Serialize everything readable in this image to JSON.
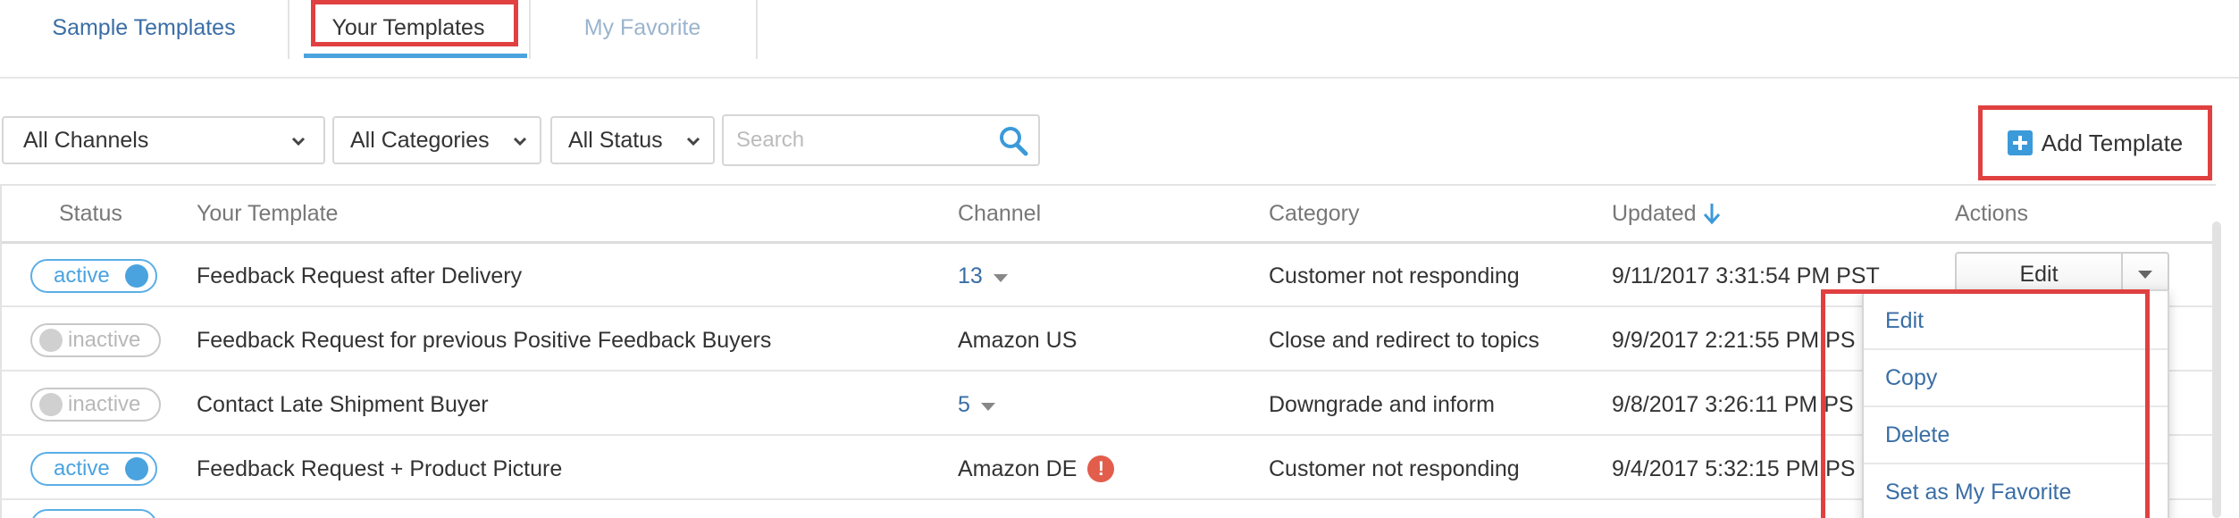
{
  "tabs": [
    {
      "label": "Sample Templates"
    },
    {
      "label": "Your Templates"
    },
    {
      "label": "My Favorite"
    }
  ],
  "filters": {
    "channel": "All Channels",
    "category": "All Categories",
    "status": "All Status",
    "search_placeholder": "Search"
  },
  "add_template_label": "Add Template",
  "columns": {
    "status": "Status",
    "template": "Your Template",
    "channel": "Channel",
    "category": "Category",
    "updated": "Updated",
    "actions": "Actions"
  },
  "rows": [
    {
      "status": "active",
      "name": "Feedback Request after Delivery",
      "channel": "13",
      "category": "Customer not responding",
      "updated": "9/11/2017 3:31:54 PM PST"
    },
    {
      "status": "inactive",
      "name": "Feedback Request for previous Positive Feedback Buyers",
      "channel": "Amazon US",
      "category": "Close and redirect to topics",
      "updated": "9/9/2017 2:21:55 PM PS"
    },
    {
      "status": "inactive",
      "name": "Contact Late Shipment Buyer",
      "channel": "5",
      "category": "Downgrade and inform",
      "updated": "9/8/2017 3:26:11 PM PS"
    },
    {
      "status": "active",
      "name": "Feedback Request + Product Picture",
      "channel": "Amazon DE",
      "category": "Customer not responding",
      "updated": "9/4/2017 5:32:15 PM PS"
    }
  ],
  "row_actions": {
    "edit_label": "Edit"
  },
  "menu": [
    {
      "label": "Edit"
    },
    {
      "label": "Copy"
    },
    {
      "label": "Delete"
    },
    {
      "label": "Set as My Favorite"
    }
  ],
  "colors": {
    "accent": "#4aa3df",
    "link": "#3a6ea5",
    "highlight": "#e04040",
    "warning": "#e35d4c"
  },
  "icons": {
    "search": "search-icon",
    "add": "plus-icon",
    "sort": "arrow-down-icon",
    "dropdown": "chevron-down-icon",
    "warning": "exclamation-icon"
  }
}
